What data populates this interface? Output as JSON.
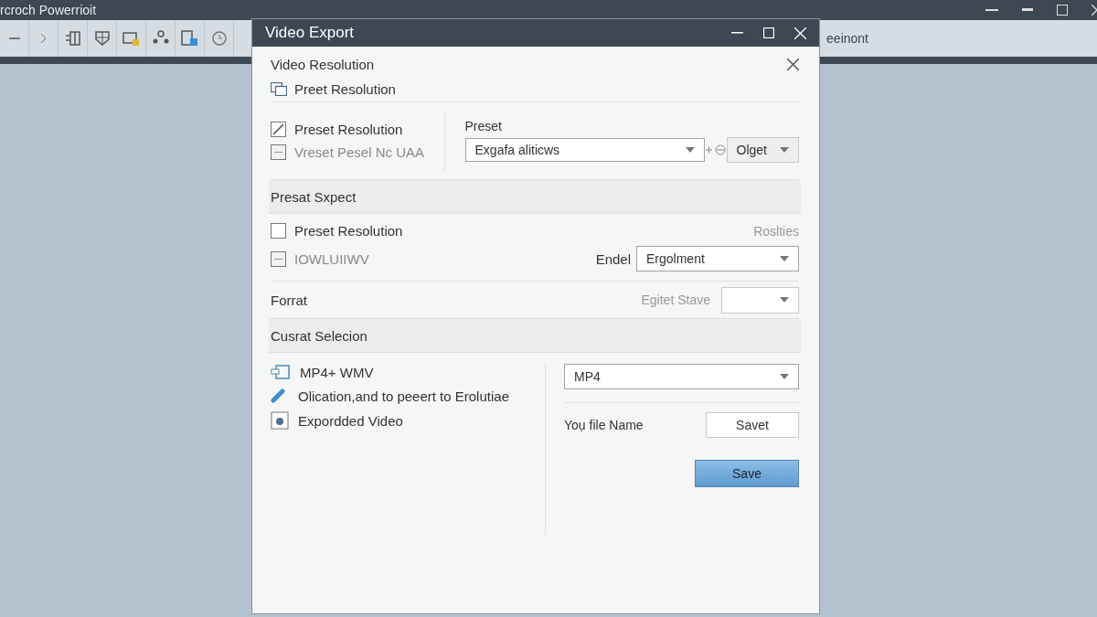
{
  "app": {
    "title": "rcroch Powerrioit",
    "toolbar_text": "eeinont"
  },
  "dialog": {
    "title": "Video Export",
    "heading": "Video Resolution",
    "subheading": "Preet Resolution",
    "options": [
      {
        "label": "Preset Resolution",
        "checked": true,
        "disabled": false
      },
      {
        "label": "Vreset Pesel Nc UAA",
        "checked": false,
        "disabled": true
      }
    ],
    "preset": {
      "label": "Preset",
      "value": "Exgafa aliticws",
      "button": "Olget"
    },
    "section1": "Presat Sxpect",
    "options2": [
      {
        "label": "Preset Resolution",
        "checked": false,
        "disabled": false
      },
      {
        "label": "IOWLUIIWV",
        "checked": false,
        "disabled": true
      }
    ],
    "hint": "Roslties",
    "endel": {
      "label": "Endel",
      "value": "Ergolment"
    },
    "format": {
      "label": "Forrat",
      "hint": "Egitet Stave"
    },
    "section2": "Cusrat Selecion",
    "list": [
      {
        "kind": "convert",
        "label": "MP4+ WMV"
      },
      {
        "kind": "link",
        "label": "Olication,and to peeert to Erolutiae"
      },
      {
        "kind": "video",
        "label": "Expordded Video"
      }
    ],
    "format_value": "MP4",
    "file_label": "Yoụ file Name",
    "secondary_button": "Savet",
    "primary_button": "Save"
  }
}
